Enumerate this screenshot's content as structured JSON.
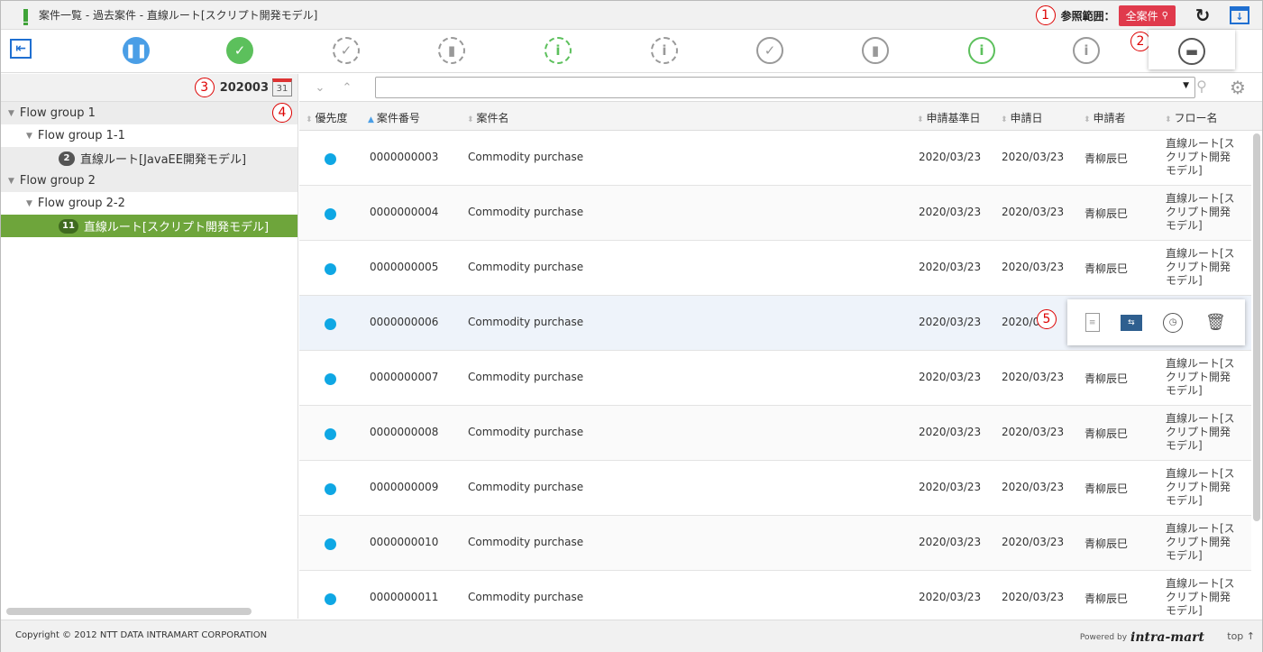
{
  "window": {
    "title": "案件一覧 - 過去案件 - 直線ルート[スクリプト開発モデル]"
  },
  "header": {
    "scope_label": "参照範囲：",
    "scope_value": "全案件",
    "annotations": [
      "1",
      "2",
      "3",
      "4",
      "5"
    ]
  },
  "date_selector": {
    "value": "202003",
    "calendar_day": "31"
  },
  "tree": [
    {
      "level": 0,
      "label": "Flow group 1",
      "arrow": "▼"
    },
    {
      "level": 1,
      "label": "Flow group 1-1",
      "arrow": "▼"
    },
    {
      "level": 2,
      "label": "直線ルート[JavaEE開発モデル]",
      "count": "2"
    },
    {
      "level": 0,
      "label": "Flow group 2",
      "arrow": "▼"
    },
    {
      "level": 1,
      "label": "Flow group 2-2",
      "arrow": "▼"
    },
    {
      "level": 2,
      "label": "直線ルート[スクリプト開発モデル]",
      "count": "11",
      "selected": true
    }
  ],
  "table": {
    "headers": [
      "優先度",
      "案件番号",
      "案件名",
      "申請基準日",
      "申請日",
      "申請者",
      "フロー名"
    ],
    "rows": [
      {
        "id": "0000000003",
        "name": "Commodity purchase",
        "base_date": "2020/03/23",
        "date": "2020/03/23",
        "applicant": "青柳辰巳",
        "flow": "直線ルート[スクリプト開発モデル]"
      },
      {
        "id": "0000000004",
        "name": "Commodity purchase",
        "base_date": "2020/03/23",
        "date": "2020/03/23",
        "applicant": "青柳辰巳",
        "flow": "直線ルート[スクリプト開発モデル]"
      },
      {
        "id": "0000000005",
        "name": "Commodity purchase",
        "base_date": "2020/03/23",
        "date": "2020/03/23",
        "applicant": "青柳辰巳",
        "flow": "直線ルート[スクリプト開発モデル]"
      },
      {
        "id": "0000000006",
        "name": "Commodity purchase",
        "base_date": "2020/03/23",
        "date": "2020/0",
        "applicant": "",
        "flow": ""
      },
      {
        "id": "0000000007",
        "name": "Commodity purchase",
        "base_date": "2020/03/23",
        "date": "2020/03/23",
        "applicant": "青柳辰巳",
        "flow": "直線ルート[スクリプト開発モデル]"
      },
      {
        "id": "0000000008",
        "name": "Commodity purchase",
        "base_date": "2020/03/23",
        "date": "2020/03/23",
        "applicant": "青柳辰巳",
        "flow": "直線ルート[スクリプト開発モデル]"
      },
      {
        "id": "0000000009",
        "name": "Commodity purchase",
        "base_date": "2020/03/23",
        "date": "2020/03/23",
        "applicant": "青柳辰巳",
        "flow": "直線ルート[スクリプト開発モデル]"
      },
      {
        "id": "0000000010",
        "name": "Commodity purchase",
        "base_date": "2020/03/23",
        "date": "2020/03/23",
        "applicant": "青柳辰巳",
        "flow": "直線ルート[スクリプト開発モデル]"
      },
      {
        "id": "0000000011",
        "name": "Commodity purchase",
        "base_date": "2020/03/23",
        "date": "2020/03/23",
        "applicant": "青柳辰巳",
        "flow": "直線ルート[スクリプト開発モデル]"
      }
    ]
  },
  "footer": {
    "copyright": "Copyright © 2012 NTT DATA INTRAMART CORPORATION",
    "powered_by": "Powered by",
    "logo": "intra-mart",
    "top_link": "top ↑"
  },
  "colors": {
    "accent_blue": "#1f6fd1",
    "scope_badge": "#e03a4c",
    "selected_tree": "#6ea53b",
    "priority_dot": "#0fa7e4",
    "annotation": "#d00000"
  }
}
